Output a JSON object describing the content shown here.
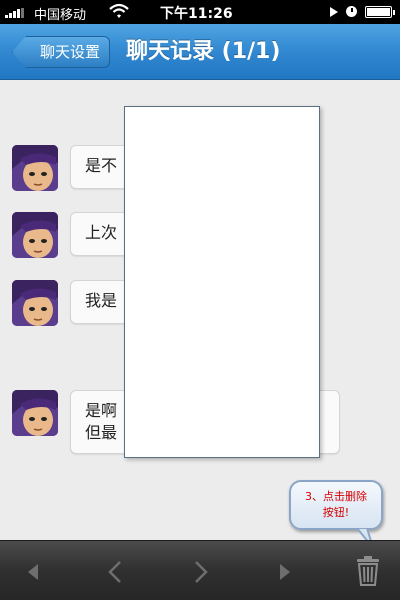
{
  "status_bar": {
    "carrier": "中国移动",
    "time": "下午11:26",
    "signal_bars": 4,
    "battery_level": 1.0
  },
  "nav": {
    "back_label": "聊天设置",
    "title": "聊天记录 (1/1)"
  },
  "messages": [
    {
      "text": "是不"
    },
    {
      "text": "上次"
    },
    {
      "text": "我是"
    },
    {
      "lines": [
        "是啊",
        "但最"
      ]
    }
  ],
  "callout": {
    "line1": "3、点击删除",
    "line2": "按钮!"
  },
  "toolbar": {
    "icons": [
      "first-page-icon",
      "previous-page-icon",
      "next-page-icon",
      "last-page-icon",
      "trash-icon"
    ]
  },
  "colors": {
    "nav_blue": "#2f86cf",
    "callout_text": "#d40000",
    "toolbar_bg": "#303030"
  }
}
